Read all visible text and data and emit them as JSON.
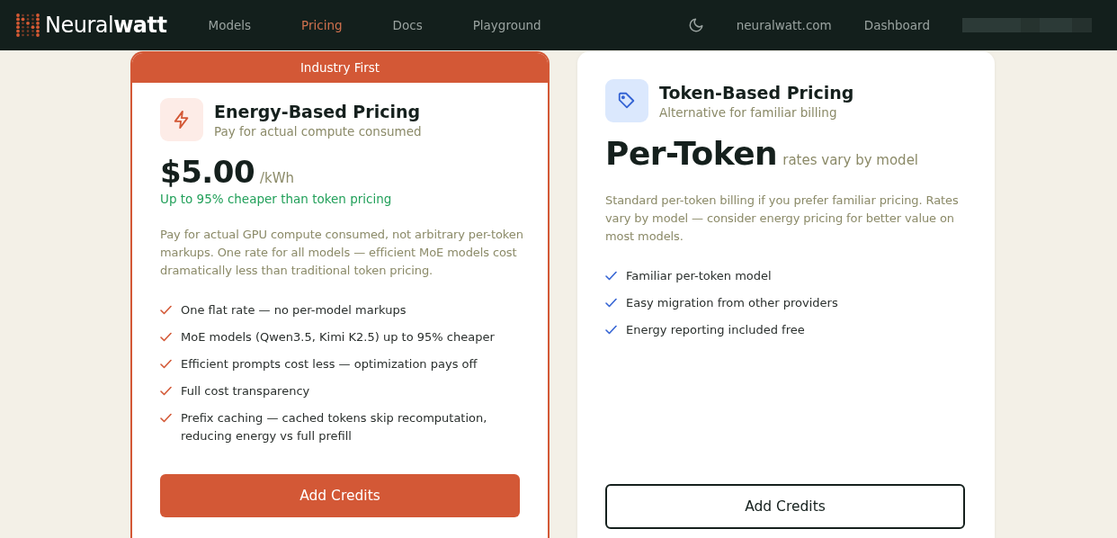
{
  "header": {
    "logo": "Neural**watt**",
    "nav": [
      {
        "label": "Models",
        "selected": false
      },
      {
        "label": "Pricing",
        "selected": true
      },
      {
        "label": "Docs",
        "selected": false
      },
      {
        "label": "Playground",
        "selected": false
      }
    ],
    "links": [
      "neuralwatt.com",
      "Dashboard"
    ]
  },
  "cards": [
    {
      "featured": true,
      "badge": "Industry First",
      "kind": "energy",
      "title": "Energy-Based Pricing",
      "subtitle": "Pay for actual compute consumed",
      "price": "$5.00",
      "unit": "/kWh",
      "savings": "Up to 95% cheaper than token pricing",
      "description": "Pay for actual GPU compute consumed, not arbitrary per-token markups. One rate for all models — efficient MoE models cost dramatically less than traditional token pricing.",
      "features": [
        "One flat rate — no per-model markups",
        "MoE models (Qwen3.5, Kimi K2.5) up to 95% cheaper",
        "Efficient prompts cost less — optimization pays off",
        "Full cost transparency",
        "Prefix caching — cached tokens skip recomputation, reducing energy vs full prefill"
      ],
      "button": "Add Credits"
    },
    {
      "featured": false,
      "kind": "token",
      "title": "Token-Based Pricing",
      "subtitle": "Alternative for familiar billing",
      "price": "Per-Token",
      "unit": "rates vary by model",
      "description": "Standard per-token billing if you prefer familiar pricing. Rates vary by model — consider energy pricing for better value on most models.",
      "features": [
        "Familiar per-token model",
        "Easy migration from other providers",
        "Energy reporting included free"
      ],
      "button": "Add Credits"
    }
  ]
}
